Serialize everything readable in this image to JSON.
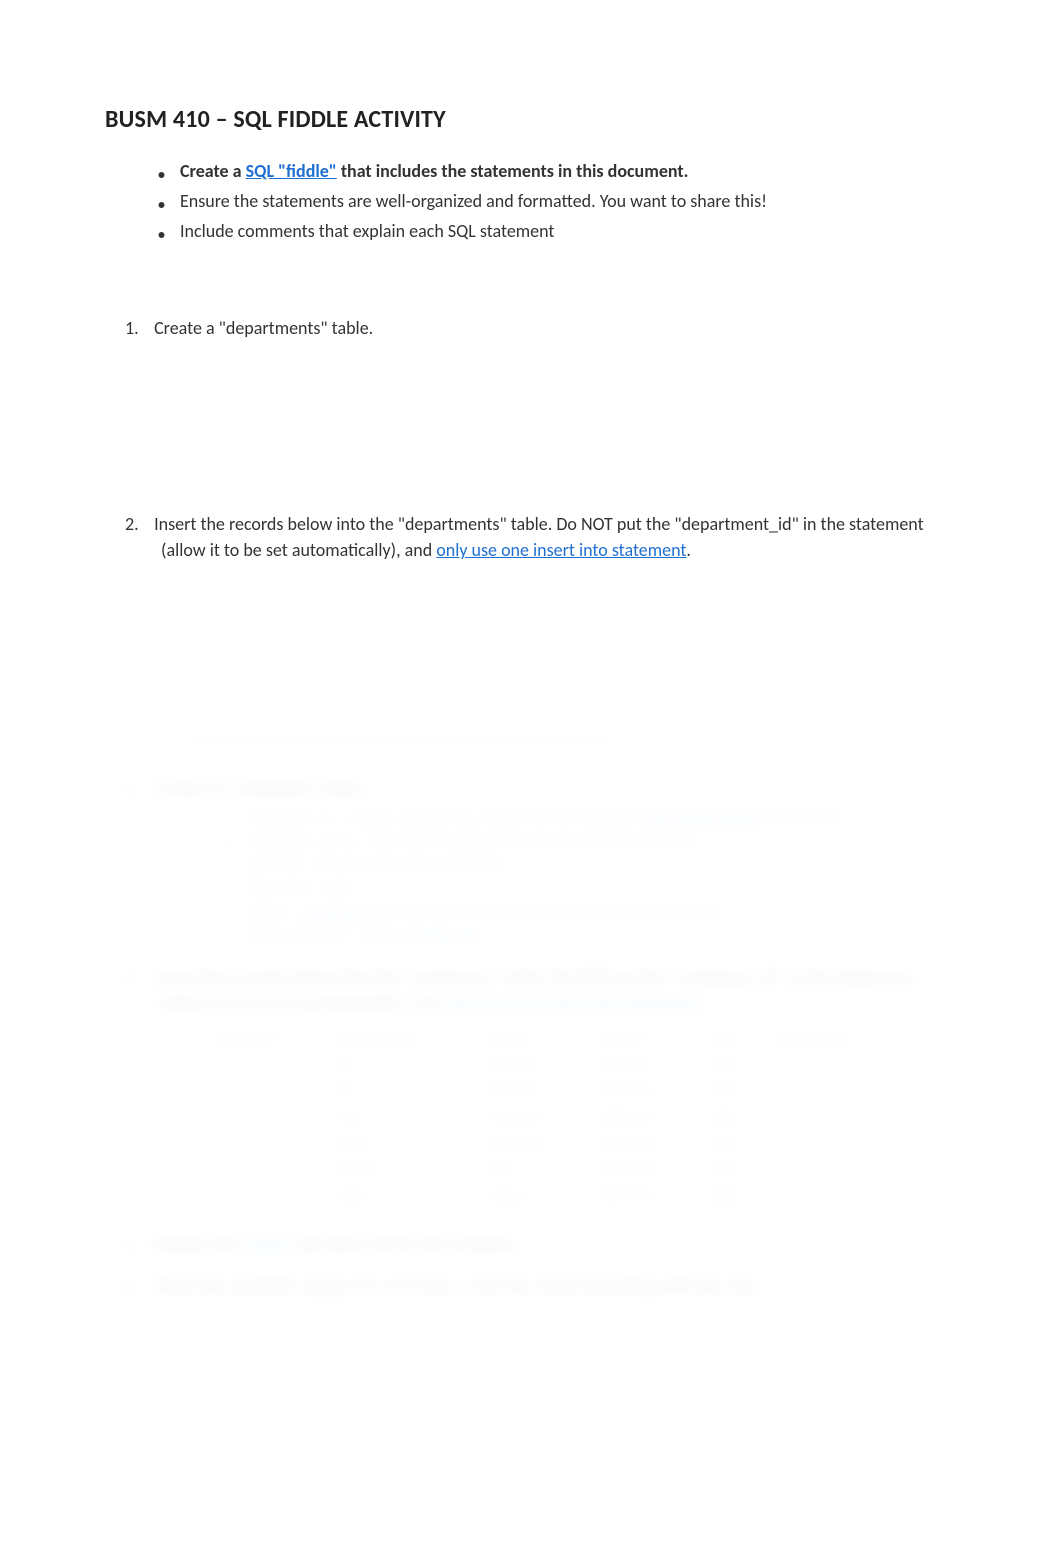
{
  "title": "BUSM 410 – SQL FIDDLE ACTIVITY",
  "intro": {
    "item1_pre": "Create a",
    "item1_link": "SQL \"fiddle\"",
    "item1_post": "that includes the statements in this document.",
    "item2": "Ensure the statements are well-organized and formatted.  You want to share this!",
    "item3": "Include comments that explain each SQL statement"
  },
  "questions": {
    "q1_num": "1.",
    "q1_text": "Create a \"departments\" table.",
    "q2_num": "2.",
    "q2_text_a": "Insert the records below into the \"departments\" table.   Do NOT put the \"department_id\" in the statement (allow it to be set automatically), and",
    "q2_link": "only use one insert into statement",
    "q2_text_b": "."
  },
  "hidden": {
    "q3_num": "3.",
    "q3_text": "Create an \"employee\" table.",
    "sub": {
      "a_lbl": "a.",
      "a_text_pre": "employee_id – integer, primary key, should not be null and is",
      "a_link": "auto-incremented",
      "a_text_post": "with entries",
      "b_lbl": "b.",
      "b_text": "employee_name – this is the employee surname + initials for the first",
      "c_lbl": "c.",
      "c_text": "job_title – the job title held at (varchar)",
      "d_lbl": "d.",
      "d_text": "hire_date – date",
      "e_lbl": "e.",
      "e_text_pre": "salary –",
      "e_link": "a decimal",
      "e_text_post": "data type up to 9 digits (where the data has up to 2 dp)",
      "f_lbl": "f.",
      "f_text_pre": "department_id – integer,",
      "f_link": "foreign key"
    },
    "q4_num": "4.",
    "q4_text_a": "Insert the records below into the \"employees\" table. Do NOT put the \"employee_id\" in the statement (allow it to be set automatically), and",
    "q4_link": "only use one insert into statement",
    "q4_text_b": ".",
    "table": {
      "headers": [
        "employee_id",
        "employee_name",
        "job_title",
        "hire_date",
        "salary",
        "department_id"
      ],
      "rows": [
        [
          "1",
          "Eric",
          "Developer",
          "2005-01-01",
          "50000",
          "1"
        ],
        [
          "2",
          "Elsa",
          "Developer",
          "2007-03-02",
          "45000",
          "1"
        ],
        [
          "3",
          "Carla",
          "Accountant",
          "2009-04-04",
          "55000",
          "2"
        ],
        [
          "4",
          "Cooper",
          "Accountant",
          "2008-05-06",
          "50000",
          "2"
        ],
        [
          "5",
          "Emmett",
          "Nurse",
          "2004-03-03",
          "65000",
          "3"
        ],
        [
          "6",
          "Adelyn",
          "Engineer",
          "2010-07-02",
          "50000",
          "4"
        ]
      ]
    },
    "q5_num": "5.",
    "q5_text_pre": "Display the",
    "q5_link": "unique",
    "q5_text_post": "job titles within the company.",
    "q6_num": "6.",
    "q6_text": "Show the available ranges of a x/% raise – sort the result ascending with the row."
  }
}
